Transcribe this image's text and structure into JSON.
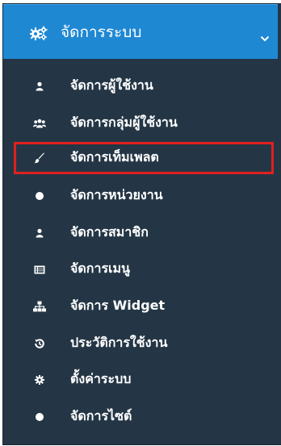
{
  "header": {
    "title": "จัดการระบบ",
    "icon": "gears-icon",
    "toggle_icon": "chevron-down-icon",
    "background": "#1f88d3"
  },
  "sidebar": {
    "background": "#243645",
    "highlight_color": "#e0201f",
    "items": [
      {
        "label": "จัดการผู้ใช้งาน",
        "icon": "user-icon"
      },
      {
        "label": "จัดการกลุ่มผู้ใช้งาน",
        "icon": "users-icon"
      },
      {
        "label": "จัดการเท็มเพลต",
        "icon": "paint-brush-icon",
        "highlighted": true
      },
      {
        "label": "จัดการหน่วยงาน",
        "icon": "circle-icon"
      },
      {
        "label": "จัดการสมาชิก",
        "icon": "user-icon"
      },
      {
        "label": "จัดการเมนู",
        "icon": "list-alt-icon"
      },
      {
        "label": "จัดการ Widget",
        "icon": "sitemap-icon"
      },
      {
        "label": "ประวัติการใช้งาน",
        "icon": "history-icon"
      },
      {
        "label": "ตั้งค่าระบบ",
        "icon": "gear-icon"
      },
      {
        "label": "จัดการไซต์",
        "icon": "circle-icon"
      }
    ]
  }
}
